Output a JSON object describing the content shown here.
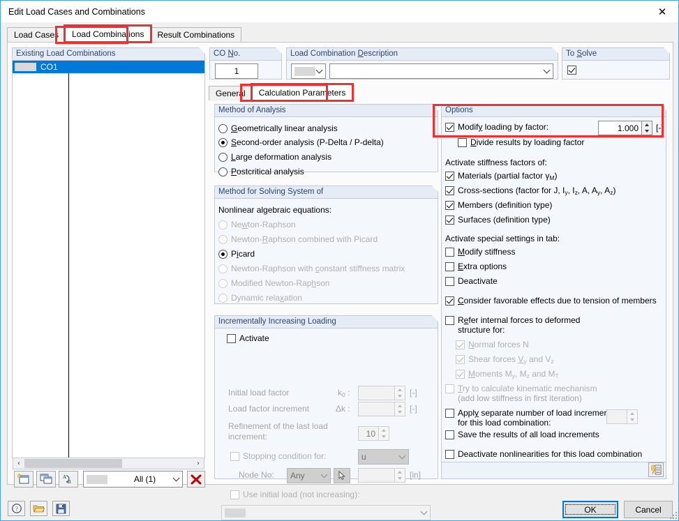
{
  "window": {
    "title": "Edit Load Cases and Combinations",
    "close_icon": "close-icon"
  },
  "tabs": [
    {
      "label": "Load Cases",
      "active": false
    },
    {
      "label": "Load Combinations",
      "active": true
    },
    {
      "label": "Result Combinations",
      "active": false
    }
  ],
  "existing": {
    "caption": "Existing Load Combinations",
    "rows": [
      {
        "name": "CO1",
        "desc": ""
      }
    ],
    "scroll": {
      "left_arrow": "‹",
      "right_arrow": "›"
    }
  },
  "list_toolbar": {
    "new_button": "new-combination-icon",
    "copy_button": "copy-combination-icon",
    "renumber_button": "renumber-icon",
    "filter_value": "All (1)",
    "delete_button": "delete-icon"
  },
  "co_no": {
    "caption": "CO No.",
    "value": "1"
  },
  "description": {
    "caption": "Load Combination Description",
    "value": "",
    "prefix_swatch": "color-swatch"
  },
  "to_solve": {
    "caption": "To Solve",
    "checked": true
  },
  "inner_tabs": [
    {
      "label": "General",
      "active": false
    },
    {
      "label": "Calculation Parameters",
      "active": true
    }
  ],
  "method_of_analysis": {
    "caption": "Method of Analysis",
    "options": [
      {
        "label": "Geometrically linear analysis",
        "accel": "G",
        "selected": false
      },
      {
        "label": "Second-order analysis (P-Delta / P-delta)",
        "accel": "S",
        "selected": true
      },
      {
        "label": "Large deformation analysis",
        "accel": "L",
        "selected": false
      },
      {
        "label": "Postcritical analysis",
        "accel": "P",
        "selected": false
      }
    ]
  },
  "method_for_solving": {
    "caption": "Method for Solving System of",
    "subtitle": "Nonlinear algebraic equations:",
    "options": [
      {
        "label": "Newton-Raphson",
        "selected": false,
        "disabled": true
      },
      {
        "label": "Newton-Raphson combined with Picard",
        "selected": false,
        "disabled": true
      },
      {
        "label": "Picard",
        "selected": true,
        "disabled": false
      },
      {
        "label": "Newton-Raphson with constant stiffness matrix",
        "selected": false,
        "disabled": true
      },
      {
        "label": "Modified Newton-Raphson",
        "selected": false,
        "disabled": true
      },
      {
        "label": "Dynamic relaxation",
        "selected": false,
        "disabled": true
      }
    ]
  },
  "incremental": {
    "caption": "Incrementally Increasing Loading",
    "activate": {
      "label": "Activate",
      "checked": false
    },
    "initial_load_factor": {
      "label": "Initial load factor",
      "symbol": "k",
      "symbol_sub": "0",
      "sep": ":",
      "value": "",
      "unit": "[-]"
    },
    "load_factor_increment": {
      "label": "Load factor increment",
      "symbol": "Δk",
      "sep": ":",
      "value": "",
      "unit": "[-]"
    },
    "refinement": {
      "label_line1": "Refinement of the last load",
      "label_line2": "increment:",
      "value": "10"
    },
    "stopping_condition": {
      "label": "Stopping condition for:",
      "checked": false,
      "value": "u"
    },
    "node_no": {
      "label": "Node No:",
      "value": "Any",
      "pick_icon": "pick-node-icon",
      "number": "",
      "unit": "[in]"
    },
    "use_initial_load": {
      "label": "Use initial load (not increasing):",
      "checked": false,
      "value": ""
    }
  },
  "options": {
    "caption": "Options",
    "modify_loading": {
      "label": "Modify loading by factor:",
      "checked": true,
      "value": "1.000",
      "unit": "[-]"
    },
    "divide_results": {
      "label": "Divide results by loading factor",
      "checked": false
    },
    "stiffness_header": "Activate stiffness factors of:",
    "stiffness": [
      {
        "label": "Materials (partial factor γM)",
        "checked": true
      },
      {
        "label": "Cross-sections (factor for J, Iy, Iz, A, Ay, Az)",
        "checked": true
      },
      {
        "label": "Members (definition type)",
        "checked": true
      },
      {
        "label": "Surfaces (definition type)",
        "checked": true
      }
    ],
    "special_header": "Activate special settings in tab:",
    "special": [
      {
        "label": "Modify stiffness",
        "checked": false
      },
      {
        "label": "Extra options",
        "checked": false
      },
      {
        "label": "Deactivate",
        "checked": false
      }
    ],
    "favorable": {
      "label": "Consider favorable effects due to tension of members",
      "checked": true
    },
    "refer_internal": {
      "line1": "Refer internal forces to deformed",
      "line2": "structure for:",
      "checked": false
    },
    "refer_sub": [
      {
        "label": "Normal forces N",
        "checked": true,
        "disabled": true
      },
      {
        "label": "Shear forces Vy and Vz",
        "checked": true,
        "disabled": true
      },
      {
        "label": "Moments My, Mz and MT",
        "checked": true,
        "disabled": true
      }
    ],
    "kinematic": {
      "line1": "Try to calculate kinematic mechanism",
      "line2": "(add low stiffness in first iteration)",
      "checked": false,
      "disabled": true
    },
    "apply_increments": {
      "line1": "Apply separate number of load increments",
      "line2": "for this load combination:",
      "checked": false,
      "value": ""
    },
    "save_results": {
      "label": "Save the results of all load increments",
      "checked": false
    },
    "deactivate_nonlin": {
      "label": "Deactivate nonlinearities for this load combination",
      "checked": false
    },
    "footer_icon": "calculation-diagram-icon"
  },
  "bottom_bar": {
    "help_icon": "help-icon",
    "open_icon": "open-folder-icon",
    "save_icon": "save-icon",
    "ok": "OK",
    "cancel": "Cancel"
  },
  "colors": {
    "accent": "#0078d7",
    "highlight": "#f03030",
    "caption_text": "#2b4570",
    "group_bg": "#f4f7fb"
  }
}
